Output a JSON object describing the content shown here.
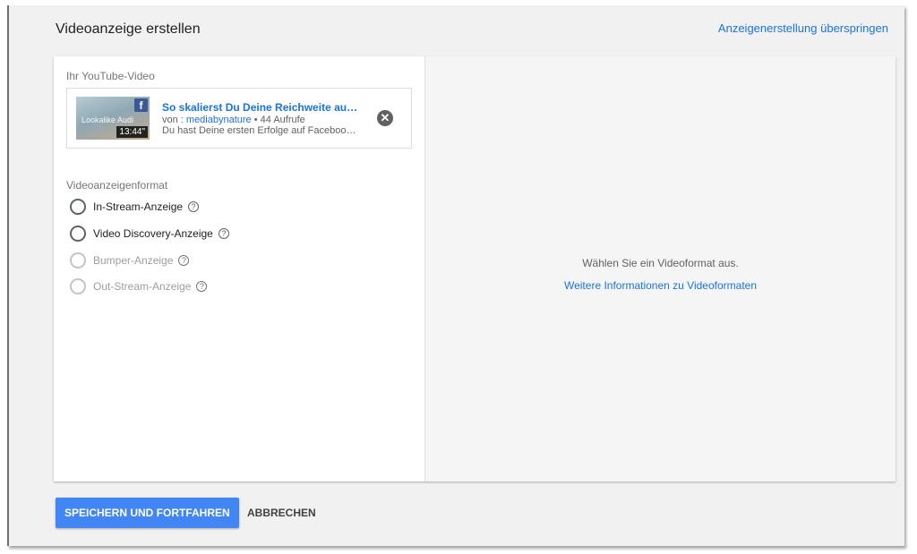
{
  "header": {
    "title": "Videoanzeige erstellen",
    "skip_link": "Anzeigenerstellung überspringen"
  },
  "video_section": {
    "label": "Ihr YouTube-Video",
    "video": {
      "title": "So skalierst Du Deine Reichweite auf Fa...",
      "by_prefix": "von : ",
      "channel": "mediabynature",
      "views": " • 44 Aufrufe",
      "description": "Du hast Deine ersten Erfolge auf Facebook ...",
      "duration": "13:44\"",
      "thumb_text": "Lookalike Audi",
      "brand_icon": "facebook-icon"
    }
  },
  "format_section": {
    "label": "Videoanzeigenformat",
    "options": [
      {
        "label": "In-Stream-Anzeige",
        "enabled": true
      },
      {
        "label": "Video Discovery-Anzeige",
        "enabled": true
      },
      {
        "label": "Bumper-Anzeige",
        "enabled": false
      },
      {
        "label": "Out-Stream-Anzeige",
        "enabled": false
      }
    ]
  },
  "preview": {
    "message": "Wählen Sie ein Videoformat aus.",
    "link": "Weitere Informationen zu Videoformaten"
  },
  "actions": {
    "save": "SPEICHERN UND FORTFAHREN",
    "cancel": "ABBRECHEN"
  },
  "colors": {
    "accent": "#1a73e8",
    "primary_button": "#4285f4",
    "facebook": "#3b5998"
  }
}
